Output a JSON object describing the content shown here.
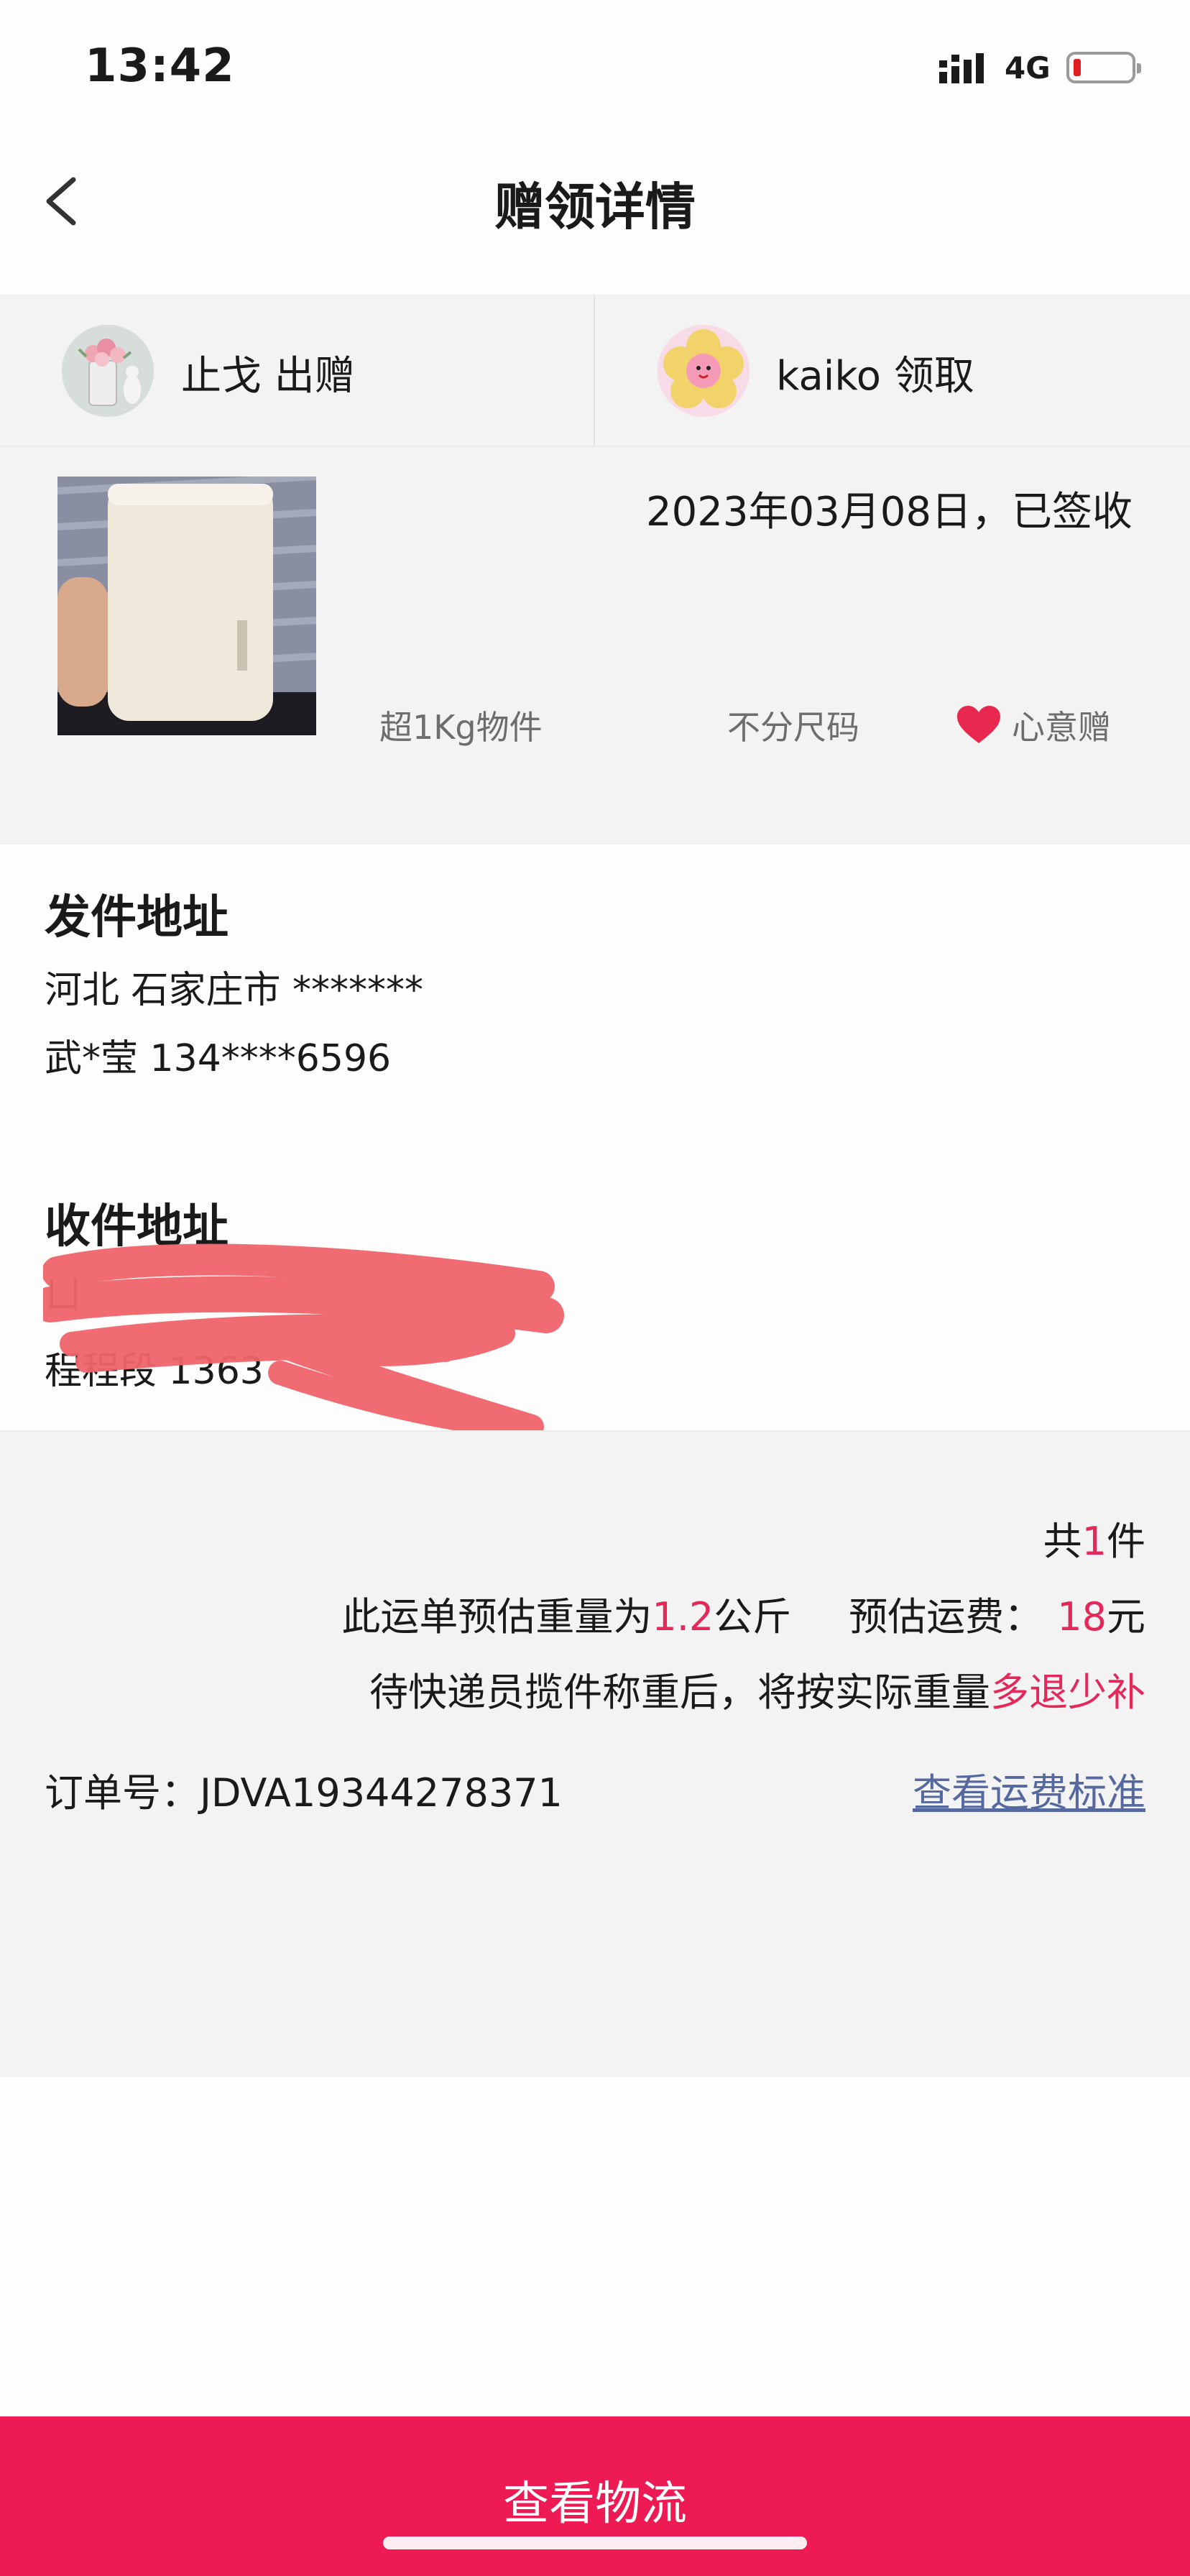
{
  "status_bar": {
    "time": "13:42",
    "network": "4G",
    "battery_level_pct": 10,
    "battery_color": "#e02020"
  },
  "nav": {
    "back_icon": "chevron-left-icon",
    "title": "赠领详情"
  },
  "parties": {
    "giver": {
      "avatar": "giver-avatar",
      "text": "止戈 出赠"
    },
    "receiver": {
      "avatar": "receiver-avatar",
      "text": "kaiko 领取"
    }
  },
  "item": {
    "photo": "item-photo",
    "date_status": "2023年03月08日，已签收",
    "weight_tag": "超1Kg物件",
    "size_tag": "不分尺码",
    "heart_icon": "heart-icon",
    "gift_type": "心意赠"
  },
  "sender": {
    "title": "发件地址",
    "region": "河北 石家庄市 *******",
    "contact": "武*莹 134****6596"
  },
  "receiver": {
    "title": "收件地址",
    "line1": "ㄩ",
    "line2": "程程段 1363"
  },
  "summary": {
    "count_prefix": "共",
    "count_value": "1",
    "count_suffix": "件",
    "weight_prefix": "此运单预估重量为",
    "weight_value": "1.2",
    "weight_unit": "公斤",
    "fee_label": "预估运费：",
    "fee_value": "18",
    "fee_unit": "元",
    "notice_prefix": "待快递员揽件称重后，将按实际重量",
    "notice_emph": "多退少补",
    "order_label": "订单号：JDVA19344278371",
    "fee_link": "查看运费标准"
  },
  "colors": {
    "accent": "#ed1a53",
    "emphasis_red": "#e5285a",
    "link": "#5569a0",
    "panel_gray": "#f3f3f3"
  },
  "bottom": {
    "button_label": "查看物流"
  }
}
